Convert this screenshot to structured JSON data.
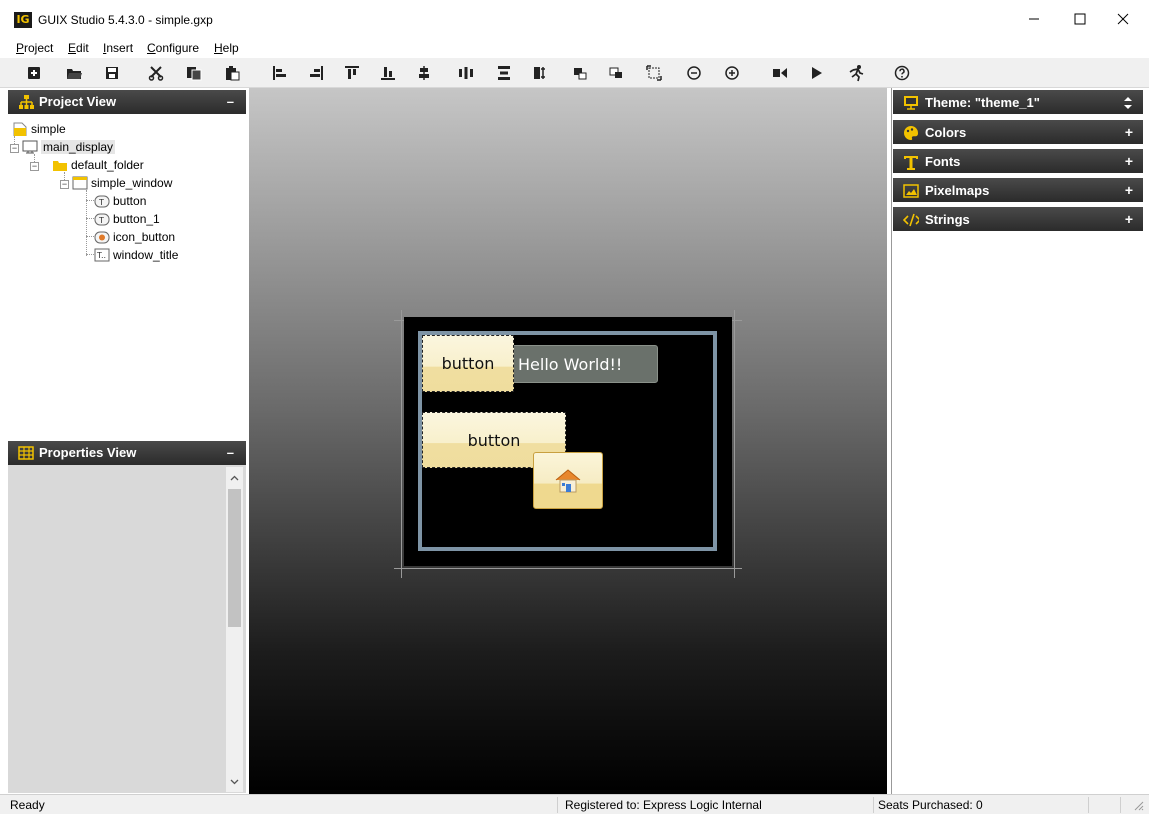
{
  "app": {
    "logo_text": "IG",
    "window_title": "GUIX Studio 5.4.3.0 - simple.gxp"
  },
  "menu": [
    {
      "mnemonic": "P",
      "rest": "roject"
    },
    {
      "mnemonic": "E",
      "rest": "dit"
    },
    {
      "mnemonic": "I",
      "rest": "nsert"
    },
    {
      "mnemonic": "C",
      "rest": "onfigure"
    },
    {
      "mnemonic": "H",
      "rest": "elp"
    }
  ],
  "toolbar": {
    "icons": [
      "new-project-icon",
      "open-folder-icon",
      "save-icon",
      "cut-icon",
      "copy-icon",
      "paste-icon",
      "align-left-icon",
      "align-right-icon",
      "align-top-icon",
      "align-bottom-icon",
      "hcenter-icon",
      "equal-hspace-icon",
      "equal-vspace-icon",
      "equal-width-icon",
      "equal-height-icon",
      "move-front-icon",
      "move-back-icon",
      "size-to-fit-icon",
      "zoom-out-icon",
      "zoom-in-icon",
      "record-macro-icon",
      "playback-icon",
      "run-icon",
      "help-icon"
    ]
  },
  "project_view": {
    "title": "Project View",
    "minimize": "–",
    "tree": [
      {
        "label": "simple",
        "icon": "project-icon"
      },
      {
        "label": "main_display",
        "icon": "monitor-icon"
      },
      {
        "label": "default_folder",
        "icon": "folder-icon"
      },
      {
        "label": "simple_window",
        "icon": "window-icon"
      },
      {
        "label": "button",
        "icon": "text-button-icon"
      },
      {
        "label": "button_1",
        "icon": "text-button-icon"
      },
      {
        "label": "icon_button",
        "icon": "icon-button-icon"
      },
      {
        "label": "window_title",
        "icon": "prompt-icon"
      }
    ]
  },
  "properties_view": {
    "title": "Properties View",
    "minimize": "–"
  },
  "canvas": {
    "title_text": "Hello World!!",
    "button_label": "button",
    "button1_label": "button"
  },
  "right_panel": {
    "theme_label": "Theme: \"theme_1\"",
    "sections": [
      {
        "label": "Colors",
        "icon": "palette-icon",
        "expander": "+"
      },
      {
        "label": "Fonts",
        "icon": "font-icon",
        "expander": "+"
      },
      {
        "label": "Pixelmaps",
        "icon": "image-icon",
        "expander": "+"
      },
      {
        "label": "Strings",
        "icon": "code-icon",
        "expander": "+"
      }
    ]
  },
  "status": {
    "left": "Ready",
    "registered": "Registered to: Express Logic Internal",
    "seats": "Seats Purchased: 0"
  },
  "colors": {
    "accent_yellow": "#f2c200",
    "panel_header": "#333333",
    "window_border": "#7e94a6"
  }
}
